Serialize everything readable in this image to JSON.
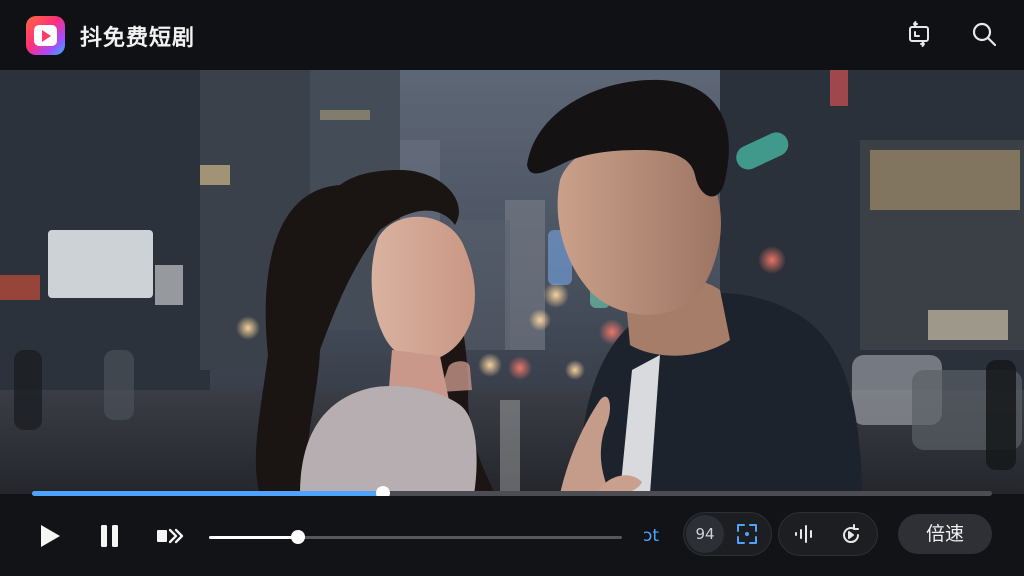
{
  "app": {
    "title": "抖免费短剧"
  },
  "header": {
    "icons": [
      "screen-rotate-icon",
      "search-icon"
    ]
  },
  "player": {
    "progress_fraction": 0.366,
    "volume_fraction": 0.215,
    "accent_color": "#4ea3ff",
    "controls": {
      "play_icon": "play-icon",
      "pause_icon": "pause-icon",
      "next_icon": "next-episode-icon",
      "subtitle_toggle_label": "ɔt",
      "resolution_label": "94",
      "fullscreen_icon": "expand-icon",
      "audio_icon": "audio-wave-icon",
      "loop_icon": "loop-icon",
      "speed_label": "倍速"
    }
  }
}
